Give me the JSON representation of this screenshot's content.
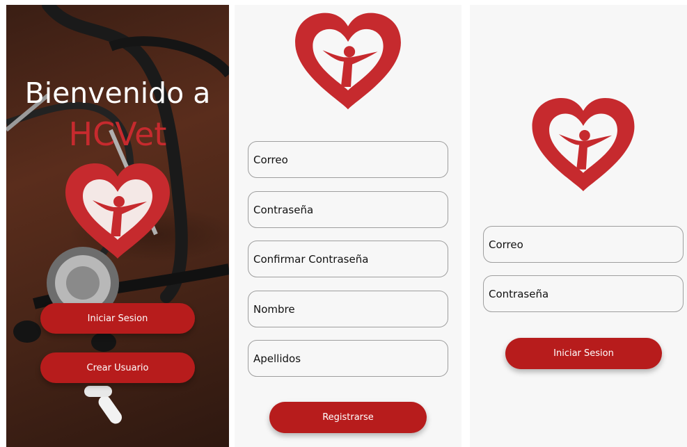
{
  "welcome": {
    "line1": "Bienvenido a",
    "line2": "HCVet",
    "login_button": "Iniciar Sesion",
    "create_user_button": "Crear Usuario"
  },
  "register": {
    "fields": [
      "Correo",
      "Contraseña",
      "Confirmar Contraseña",
      "Nombre",
      "Apellidos"
    ],
    "submit_button": "Registrarse"
  },
  "login": {
    "fields": [
      "Correo",
      "Contraseña"
    ],
    "submit_button": "Iniciar Sesion"
  },
  "colors": {
    "brand_red": "#c62a2e",
    "button_red": "#b71c1c",
    "field_border": "#9e9e9e",
    "screen_background": "#f7f7f7"
  },
  "icons": [
    "heart-person-logo"
  ]
}
